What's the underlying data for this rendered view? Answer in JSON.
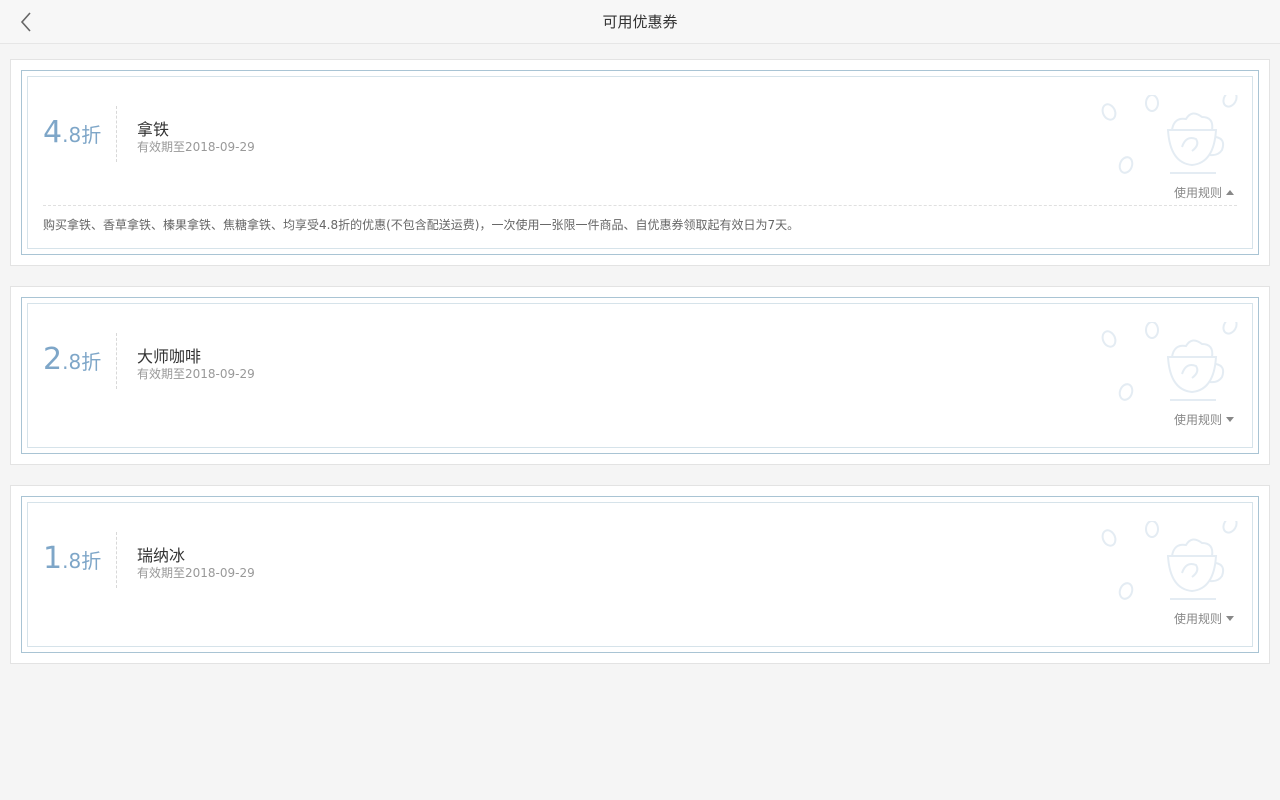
{
  "header": {
    "title": "可用优惠券",
    "back_icon": "chevron-left-icon"
  },
  "coupons": [
    {
      "discount_integer": "4",
      "discount_fraction": ".8",
      "discount_unit": "折",
      "name": "拿铁",
      "validity": "有效期至2018-09-29",
      "rules_label": "使用规则",
      "expanded": true,
      "rules_text": "购买拿铁、香草拿铁、榛果拿铁、焦糖拿铁、均享受4.8折的优惠(不包含配送运费)，一次使用一张限一件商品、自优惠券领取起有效日为7天。"
    },
    {
      "discount_integer": "2",
      "discount_fraction": ".8",
      "discount_unit": "折",
      "name": "大师咖啡",
      "validity": "有效期至2018-09-29",
      "rules_label": "使用规则",
      "expanded": false
    },
    {
      "discount_integer": "1",
      "discount_fraction": ".8",
      "discount_unit": "折",
      "name": "瑞纳冰",
      "validity": "有效期至2018-09-29",
      "rules_label": "使用规则",
      "expanded": false
    }
  ],
  "colors": {
    "accent": "#7ea6c8",
    "frame": "#a9c4d4",
    "background": "#f5f5f5"
  }
}
